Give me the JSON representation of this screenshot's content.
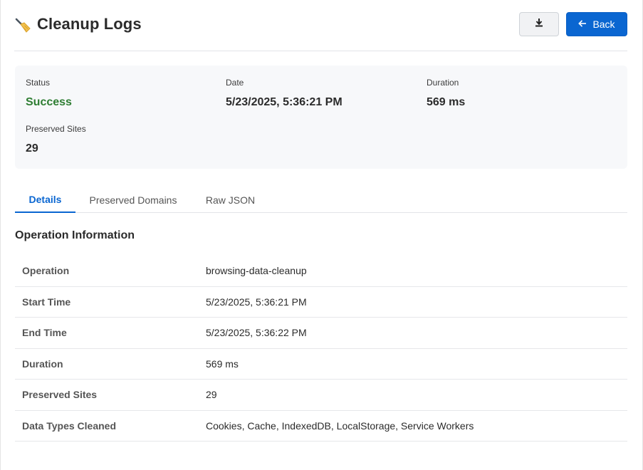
{
  "header": {
    "title": "Cleanup Logs",
    "title_icon": "broom-icon",
    "download_icon": "download-icon",
    "back_label": "Back",
    "back_icon": "arrow-left-icon"
  },
  "summary": {
    "status": {
      "label": "Status",
      "value": "Success"
    },
    "date": {
      "label": "Date",
      "value": "5/23/2025, 5:36:21 PM"
    },
    "duration": {
      "label": "Duration",
      "value": "569 ms"
    },
    "preserved": {
      "label": "Preserved Sites",
      "value": "29"
    }
  },
  "tabs": [
    {
      "label": "Details",
      "active": true
    },
    {
      "label": "Preserved Domains",
      "active": false
    },
    {
      "label": "Raw JSON",
      "active": false
    }
  ],
  "section": {
    "title": "Operation Information",
    "rows": [
      {
        "label": "Operation",
        "value": "browsing-data-cleanup"
      },
      {
        "label": "Start Time",
        "value": "5/23/2025, 5:36:21 PM"
      },
      {
        "label": "End Time",
        "value": "5/23/2025, 5:36:22 PM"
      },
      {
        "label": "Duration",
        "value": "569 ms"
      },
      {
        "label": "Preserved Sites",
        "value": "29"
      },
      {
        "label": "Data Types Cleaned",
        "value": "Cookies, Cache, IndexedDB, LocalStorage, Service Workers"
      }
    ]
  },
  "colors": {
    "accent": "#0a66d1",
    "success": "#2e7d32",
    "summary_bg": "#f7f8fa"
  }
}
